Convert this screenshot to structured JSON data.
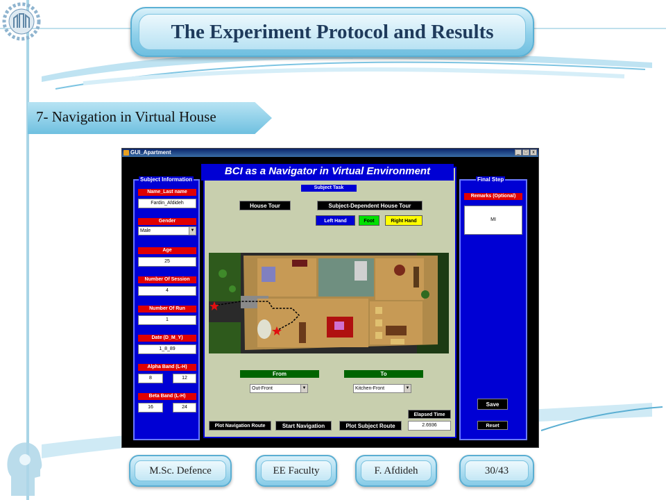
{
  "slide": {
    "title": "The Experiment Protocol and Results",
    "section": "7- Navigation in Virtual House",
    "footer": [
      "M.Sc. Defence",
      "EE Faculty",
      "F. Afdideh",
      "30/43"
    ]
  },
  "window": {
    "title": "GUI_Apartment",
    "minimize": "_",
    "maximize": "□",
    "close": "x"
  },
  "subject_info": {
    "panel_title": "Subject Information",
    "name_label": "Name_Last name",
    "name_value": "Fardin_Afdideh",
    "gender_label": "Gender",
    "gender_value": "Male",
    "age_label": "Age",
    "age_value": "25",
    "session_label": "Number Of Session",
    "session_value": "4",
    "run_label": "Number Of Run",
    "run_value": "1",
    "date_label": "Date (D_M_Y)",
    "date_value": "1_8_89",
    "alpha_label": "Alpha Band (L-H)",
    "alpha_low": "8",
    "alpha_high": "12",
    "beta_label": "Beta Band (L-H)",
    "beta_low": "16",
    "beta_high": "24"
  },
  "main": {
    "title": "BCI as a Navigator in Virtual Environment",
    "task_label": "Subject Task",
    "house_tour": "House Tour",
    "subject_tour": "Subject-Dependent House Tour",
    "left_hand": "Left Hand",
    "foot": "Foot",
    "right_hand": "Right Hand",
    "from_label": "From",
    "from_value": "Out-Front",
    "to_label": "To",
    "to_value": "Kitchen-Front",
    "elapsed_label": "Elapsed Time",
    "elapsed_value": "2.6936",
    "plot_nav": "Plot Navigation Route",
    "start_nav": "Start Navigation",
    "plot_subject": "Plot Subject Route"
  },
  "final_step": {
    "panel_title": "Final Step",
    "remarks_label": "Remarks (Optional)",
    "remarks_value": "MI",
    "save": "Save",
    "reset": "Reset"
  },
  "colors": {
    "panel_blue": "#0000d4",
    "label_red": "#e00000",
    "left_hand": "#0000d4",
    "foot": "#00e000",
    "right_hand": "#ffff00",
    "from_to_green": "#006400"
  }
}
